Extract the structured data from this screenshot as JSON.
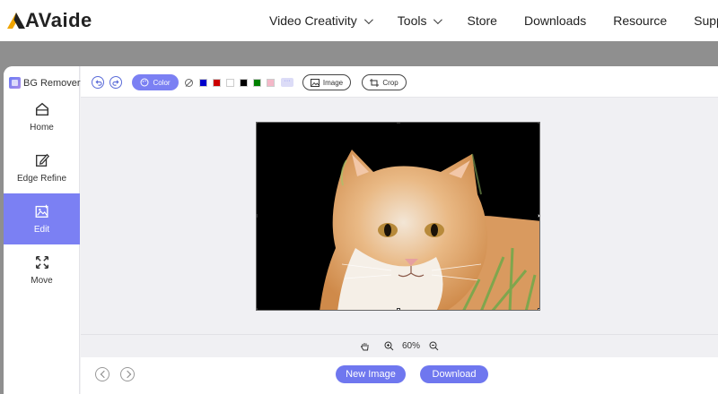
{
  "site": {
    "logo_text": "AVaide",
    "nav": [
      {
        "label": "Video Creativity",
        "has_dropdown": true
      },
      {
        "label": "Tools",
        "has_dropdown": true
      },
      {
        "label": "Store",
        "has_dropdown": false
      },
      {
        "label": "Downloads",
        "has_dropdown": false
      },
      {
        "label": "Resource",
        "has_dropdown": false
      },
      {
        "label": "Support",
        "has_dropdown": false
      }
    ]
  },
  "app": {
    "brand": "BG Remover",
    "sidebar": [
      {
        "label": "Home",
        "icon": "home-icon",
        "active": false
      },
      {
        "label": "Edge Refine",
        "icon": "edit-pen-icon",
        "active": false
      },
      {
        "label": "Edit",
        "icon": "image-edit-icon",
        "active": true
      },
      {
        "label": "Move",
        "icon": "move-arrows-icon",
        "active": false
      }
    ],
    "toolbar": {
      "color_label": "Color",
      "swatches": [
        "#0000cc",
        "#cc0000",
        "#ffffff",
        "#000000",
        "#008000",
        "#f4b8c8"
      ],
      "more_label": "···",
      "image_label": "Image",
      "crop_label": "Crop"
    },
    "zoom": {
      "value": "60%"
    },
    "bottom": {
      "new_image_label": "New Image",
      "download_label": "Download"
    }
  }
}
